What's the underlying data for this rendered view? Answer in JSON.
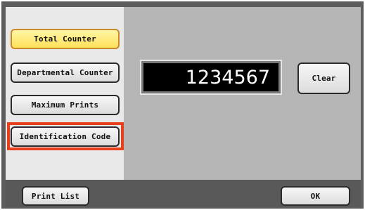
{
  "left_menu": {
    "total_counter": "Total Counter",
    "departmental_counter": "Departmental Counter",
    "maximum_prints": "Maximum Prints",
    "identification_code": "Identification Code"
  },
  "main": {
    "display_value": "1234567",
    "clear_label": "Clear"
  },
  "bottom": {
    "print_list_label": "Print List",
    "ok_label": "OK"
  },
  "colors": {
    "selected_button": "#ffe05a",
    "highlight_border": "#e8401c",
    "display_background": "#000000"
  }
}
